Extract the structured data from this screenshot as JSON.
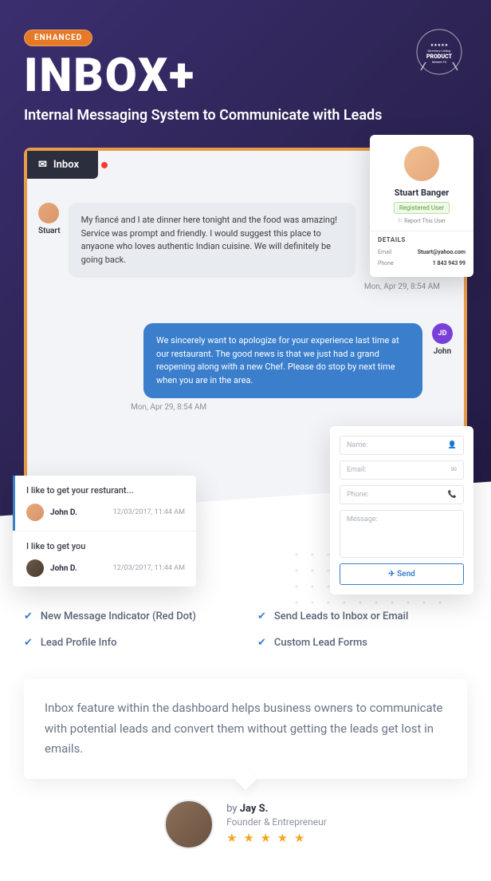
{
  "hero": {
    "badge": "ENHANCED",
    "title": "INBOX+",
    "subtitle": "Internal Messaging System to Communicate with Leads",
    "product_badge": "PRODUCT"
  },
  "mock": {
    "inbox_tab": "Inbox",
    "stuart_name": "Stuart",
    "stuart_msg": "My fiancé and I ate dinner here tonight and the food was amazing! Service was prompt and friendly. I would suggest this place to anyaone who loves authentic Indian cuisine. We will definitely be going back.",
    "ts1": "Mon, Apr 29, 8:54 AM",
    "john_name": "John",
    "john_initials": "JD",
    "reply_msg": "We sincerely want to apologize for your experience last time at our restaurant. The good news is that we just had a grand reopening along with a new Chef. Please do stop by next time when you are in the area.",
    "ts2": "Mon, Apr 29, 8:54 AM"
  },
  "profile": {
    "name": "Stuart Banger",
    "role": "Registered User",
    "report": "⚐ Report This User",
    "details_header": "DETAILS",
    "email_k": "Email",
    "email_v": "Stuart@yahoo.com",
    "phone_k": "Phone",
    "phone_v": "1 843 943 99"
  },
  "preview": {
    "item1_text": "I like to get your resturant...",
    "item1_name": "John D.",
    "item1_date": "12/03/2017, 11:44 AM",
    "item2_text": "I like to get you",
    "item2_name": "John D.",
    "item2_date": "12/03/2017, 11:44 AM"
  },
  "form": {
    "name": "Name:",
    "email": "Email:",
    "phone": "Phone:",
    "message": "Message:",
    "send": "Send"
  },
  "features": [
    "New Message Indicator (Red Dot)",
    "Send Leads to Inbox or Email",
    "Lead Profile Info",
    "Custom Lead Forms"
  ],
  "testimonial": {
    "body": "Inbox feature within the dashboard helps business owners to communicate with potential leads and convert them without getting the leads get lost in emails.",
    "by_prefix": "by ",
    "by_name": "Jay S.",
    "role": "Founder & Entrepreneur",
    "stars": "★ ★ ★ ★ ★"
  }
}
